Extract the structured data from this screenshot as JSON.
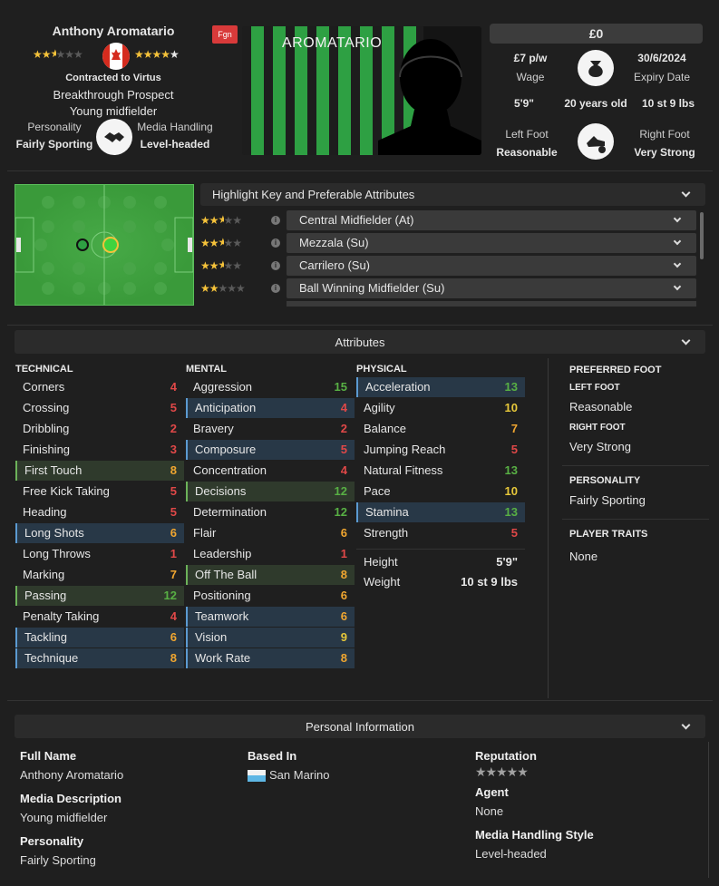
{
  "player": {
    "name": "Anthony Aromatario",
    "status_tag": "Fgn",
    "contract_text": "Contracted to Virtus",
    "prospect": "Breakthrough Prospect",
    "description": "Young midfielder",
    "personality_label": "Personality",
    "personality": "Fairly Sporting",
    "media_label": "Media Handling",
    "media": "Level-headed",
    "nation_flag": "canada-flag",
    "current_ability_stars": 2.5,
    "potential_ability_stars": 5,
    "shirt_name": "AROMATARIO",
    "kit_colors": [
      "#1d1d1d",
      "#2ea043"
    ]
  },
  "contract": {
    "value": "£0",
    "wage": "£7 p/w",
    "wage_label": "Wage",
    "expiry": "30/6/2024",
    "expiry_label": "Expiry Date",
    "height": "5'9\"",
    "age": "20 years old",
    "weight": "10 st 9 lbs",
    "left_foot_label": "Left Foot",
    "left_foot": "Reasonable",
    "right_foot_label": "Right Foot",
    "right_foot": "Very Strong"
  },
  "roles": {
    "header": "Highlight Key and Preferable Attributes",
    "items": [
      {
        "stars": 2.5,
        "label": "Central Midfielder (At)"
      },
      {
        "stars": 2.5,
        "label": "Mezzala (Su)"
      },
      {
        "stars": 2.5,
        "label": "Carrilero (Su)"
      },
      {
        "stars": 2.0,
        "label": "Ball Winning Midfielder (Su)"
      }
    ]
  },
  "attributes": {
    "header": "Attributes",
    "technical_title": "TECHNICAL",
    "mental_title": "MENTAL",
    "physical_title": "PHYSICAL",
    "technical": [
      {
        "name": "Corners",
        "value": "4",
        "hl": ""
      },
      {
        "name": "Crossing",
        "value": "5",
        "hl": ""
      },
      {
        "name": "Dribbling",
        "value": "2",
        "hl": ""
      },
      {
        "name": "Finishing",
        "value": "3",
        "hl": ""
      },
      {
        "name": "First Touch",
        "value": "8",
        "hl": "green"
      },
      {
        "name": "Free Kick Taking",
        "value": "5",
        "hl": ""
      },
      {
        "name": "Heading",
        "value": "5",
        "hl": ""
      },
      {
        "name": "Long Shots",
        "value": "6",
        "hl": "blue"
      },
      {
        "name": "Long Throws",
        "value": "1",
        "hl": ""
      },
      {
        "name": "Marking",
        "value": "7",
        "hl": ""
      },
      {
        "name": "Passing",
        "value": "12",
        "hl": "green"
      },
      {
        "name": "Penalty Taking",
        "value": "4",
        "hl": ""
      },
      {
        "name": "Tackling",
        "value": "6",
        "hl": "blue"
      },
      {
        "name": "Technique",
        "value": "8",
        "hl": "blue"
      }
    ],
    "mental": [
      {
        "name": "Aggression",
        "value": "15",
        "hl": ""
      },
      {
        "name": "Anticipation",
        "value": "4",
        "hl": "blue"
      },
      {
        "name": "Bravery",
        "value": "2",
        "hl": ""
      },
      {
        "name": "Composure",
        "value": "5",
        "hl": "blue"
      },
      {
        "name": "Concentration",
        "value": "4",
        "hl": ""
      },
      {
        "name": "Decisions",
        "value": "12",
        "hl": "green"
      },
      {
        "name": "Determination",
        "value": "12",
        "hl": ""
      },
      {
        "name": "Flair",
        "value": "6",
        "hl": ""
      },
      {
        "name": "Leadership",
        "value": "1",
        "hl": ""
      },
      {
        "name": "Off The Ball",
        "value": "8",
        "hl": "green"
      },
      {
        "name": "Positioning",
        "value": "6",
        "hl": ""
      },
      {
        "name": "Teamwork",
        "value": "6",
        "hl": "blue"
      },
      {
        "name": "Vision",
        "value": "9",
        "hl": "blue"
      },
      {
        "name": "Work Rate",
        "value": "8",
        "hl": "blue"
      }
    ],
    "physical": [
      {
        "name": "Acceleration",
        "value": "13",
        "hl": "blue"
      },
      {
        "name": "Agility",
        "value": "10",
        "hl": ""
      },
      {
        "name": "Balance",
        "value": "7",
        "hl": ""
      },
      {
        "name": "Jumping Reach",
        "value": "5",
        "hl": ""
      },
      {
        "name": "Natural Fitness",
        "value": "13",
        "hl": ""
      },
      {
        "name": "Pace",
        "value": "10",
        "hl": ""
      },
      {
        "name": "Stamina",
        "value": "13",
        "hl": "blue"
      },
      {
        "name": "Strength",
        "value": "5",
        "hl": ""
      }
    ],
    "height_label": "Height",
    "height": "5'9\"",
    "weight_label": "Weight",
    "weight": "10 st 9 lbs"
  },
  "side": {
    "preferred_foot_title": "PREFERRED FOOT",
    "left_foot_title": "LEFT FOOT",
    "left_foot": "Reasonable",
    "right_foot_title": "RIGHT FOOT",
    "right_foot": "Very Strong",
    "personality_title": "PERSONALITY",
    "personality": "Fairly Sporting",
    "traits_title": "PLAYER TRAITS",
    "traits": "None"
  },
  "personal": {
    "header": "Personal Information",
    "full_name_label": "Full Name",
    "full_name": "Anthony Aromatario",
    "media_desc_label": "Media Description",
    "media_desc": "Young midfielder",
    "personality_label": "Personality",
    "personality": "Fairly Sporting",
    "based_in_label": "Based In",
    "based_in": "San Marino",
    "reputation_label": "Reputation",
    "reputation_stars": 0,
    "agent_label": "Agent",
    "agent": "None",
    "media_style_label": "Media Handling Style",
    "media_style": "Level-headed"
  },
  "colors": {
    "red": "#e04848",
    "orange": "#f0a630",
    "yellow": "#e7c83a",
    "green": "#58b044",
    "pitch": "#3a9a3a"
  }
}
